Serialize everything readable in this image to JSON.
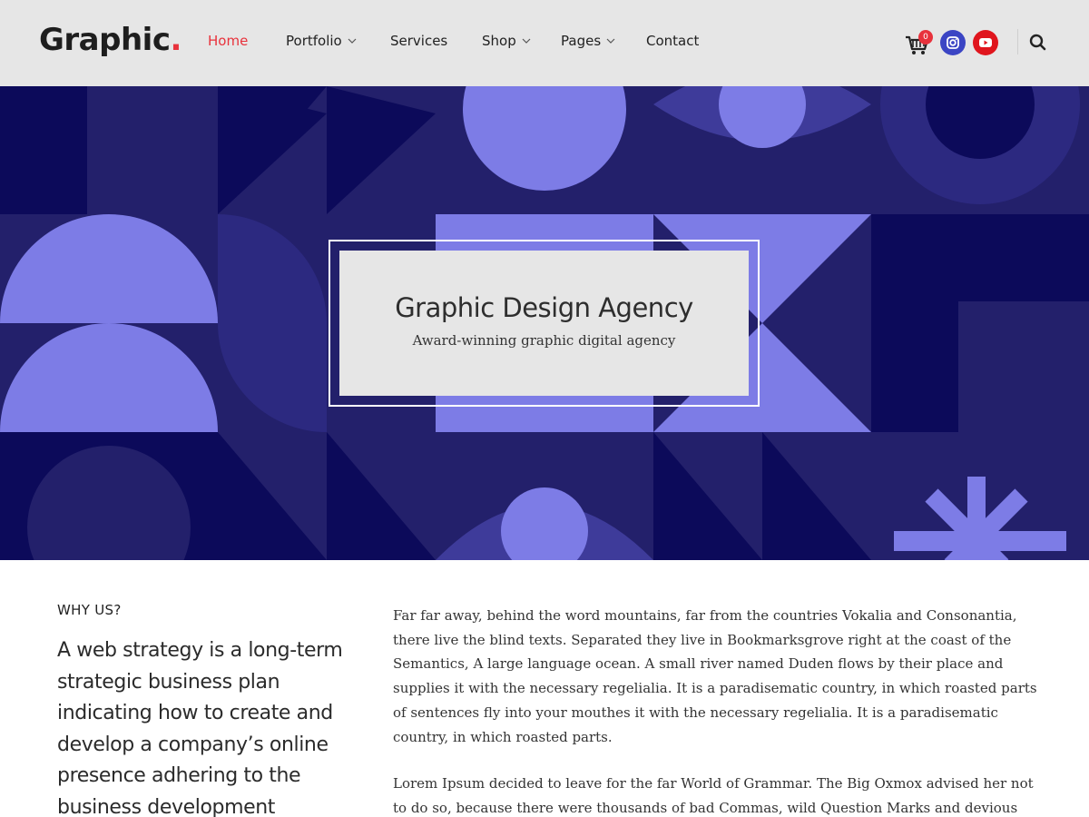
{
  "header": {
    "logo_text": "Graphic",
    "logo_dot": ".",
    "nav": [
      {
        "label": "Home",
        "active": true,
        "has_dropdown": false
      },
      {
        "label": "Portfolio",
        "active": false,
        "has_dropdown": true
      },
      {
        "label": "Services",
        "active": false,
        "has_dropdown": false
      },
      {
        "label": "Shop",
        "active": false,
        "has_dropdown": true
      },
      {
        "label": "Pages",
        "active": false,
        "has_dropdown": true
      },
      {
        "label": "Contact",
        "active": false,
        "has_dropdown": false
      }
    ],
    "cart_count": "0",
    "icons": [
      "cart-icon",
      "instagram-icon",
      "youtube-icon",
      "search-icon"
    ]
  },
  "hero": {
    "title": "Graphic Design Agency",
    "subtitle": "Award-winning graphic digital agency"
  },
  "content": {
    "eyebrow": "WHY US?",
    "lead": "A web strategy is a long-term strategic business plan indicating how to create and develop a company’s online presence adhering to the business development",
    "paragraph_1": "Far far away, behind the word mountains, far from the countries Vokalia and Consonantia, there live the blind texts. Separated they live in Bookmarksgrove right at the coast of the Semantics, A large language ocean. A small river named Duden flows by their place and supplies it with the necessary regelialia. It is a paradisematic country, in which roasted parts of sentences fly into your mouthes it with the necessary regelialia. It is a paradisematic country, in which roasted parts.",
    "paragraph_2": "Lorem Ipsum decided to leave for the far World of Grammar. The Big Oxmox advised her not to do so, because there were thousands of bad Commas, wild Question Marks and devious"
  },
  "colors": {
    "accent": "#e8323c",
    "hero_dark": "#0c0a5a",
    "hero_mid": "#23206b",
    "hero_light": "#7d7ce6",
    "instagram": "#3b45c4",
    "youtube": "#e0151d"
  }
}
